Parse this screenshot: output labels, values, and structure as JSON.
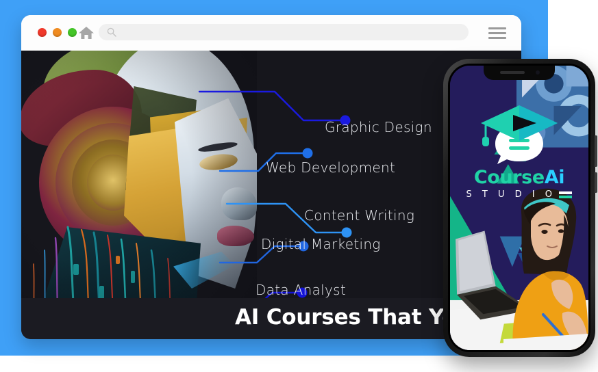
{
  "background": {
    "panel_color": "#3fa0f7",
    "page_color": "#ffffff"
  },
  "browser": {
    "traffic_lights": [
      {
        "name": "close",
        "color": "#f0392b"
      },
      {
        "name": "minimize",
        "color": "#ef8b21"
      },
      {
        "name": "zoom",
        "color": "#44c528"
      }
    ],
    "home_icon": "home-icon",
    "search": {
      "icon": "search-icon",
      "value": "",
      "placeholder": ""
    },
    "menu_icon": "hamburger-menu-icon"
  },
  "hero": {
    "background_color": "#16161c",
    "artwork": "ai-robot-head-profile",
    "headline": "AI Courses That You Sho",
    "headline_full_hint": "clipped by phone overlay",
    "labels": [
      {
        "text": "Graphic Design",
        "dot_color": "#1a1ae0"
      },
      {
        "text": "Web Development",
        "dot_color": "#1f6fe8"
      },
      {
        "text": "Content Writing",
        "dot_color": "#2e93f5"
      },
      {
        "text": "Digital Marketing",
        "dot_color": "#2166e0"
      },
      {
        "text": "Data Analyst",
        "dot_color": "#1414d8"
      }
    ]
  },
  "phone": {
    "frame_color": "#1d1d1d",
    "screen_bg": "#241c5c",
    "notch": {
      "speaker": "speaker-slot",
      "camera": "front-camera-dot"
    },
    "logo": {
      "icon": "graduation-cap-play-chat-icon",
      "brand_primary": "Course",
      "brand_accent": "Ai",
      "subtitle": "S T U D I O",
      "accent_color": "#20d3a6",
      "accent_alt": "#2ad0ff"
    },
    "photo": "girl-studying-at-laptop",
    "shapes": {
      "teal": "#14b588",
      "navy": "#241c5c",
      "blue": "#3f6fa8"
    }
  }
}
